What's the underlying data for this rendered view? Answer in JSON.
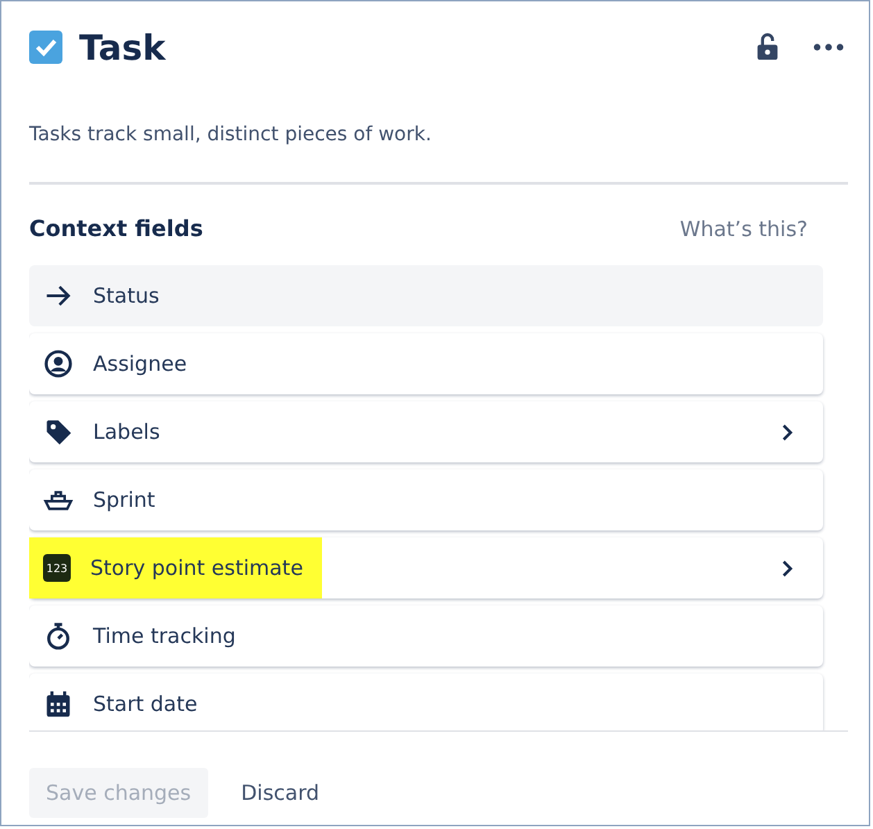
{
  "header": {
    "title": "Task",
    "checked": true,
    "description": "Tasks track small, distinct pieces of work."
  },
  "context": {
    "heading": "Context fields",
    "help_link": "What’s this?",
    "fields": [
      {
        "label": "Status",
        "kind": "arrow",
        "hovered": true,
        "highlighted": false,
        "expandable": false
      },
      {
        "label": "Assignee",
        "kind": "person",
        "hovered": false,
        "highlighted": false,
        "expandable": false
      },
      {
        "label": "Labels",
        "kind": "tag",
        "hovered": false,
        "highlighted": false,
        "expandable": true
      },
      {
        "label": "Sprint",
        "kind": "boat",
        "hovered": false,
        "highlighted": false,
        "expandable": false
      },
      {
        "label": "Story point estimate",
        "kind": "number",
        "icon_text": "123",
        "hovered": false,
        "highlighted": true,
        "expandable": true
      },
      {
        "label": "Time tracking",
        "kind": "stopwatch",
        "hovered": false,
        "highlighted": false,
        "expandable": false
      },
      {
        "label": "Start date",
        "kind": "calendar",
        "hovered": false,
        "highlighted": false,
        "expandable": false
      }
    ]
  },
  "footer": {
    "save": {
      "label": "Save changes",
      "disabled": true
    },
    "discard": {
      "label": "Discard"
    }
  }
}
